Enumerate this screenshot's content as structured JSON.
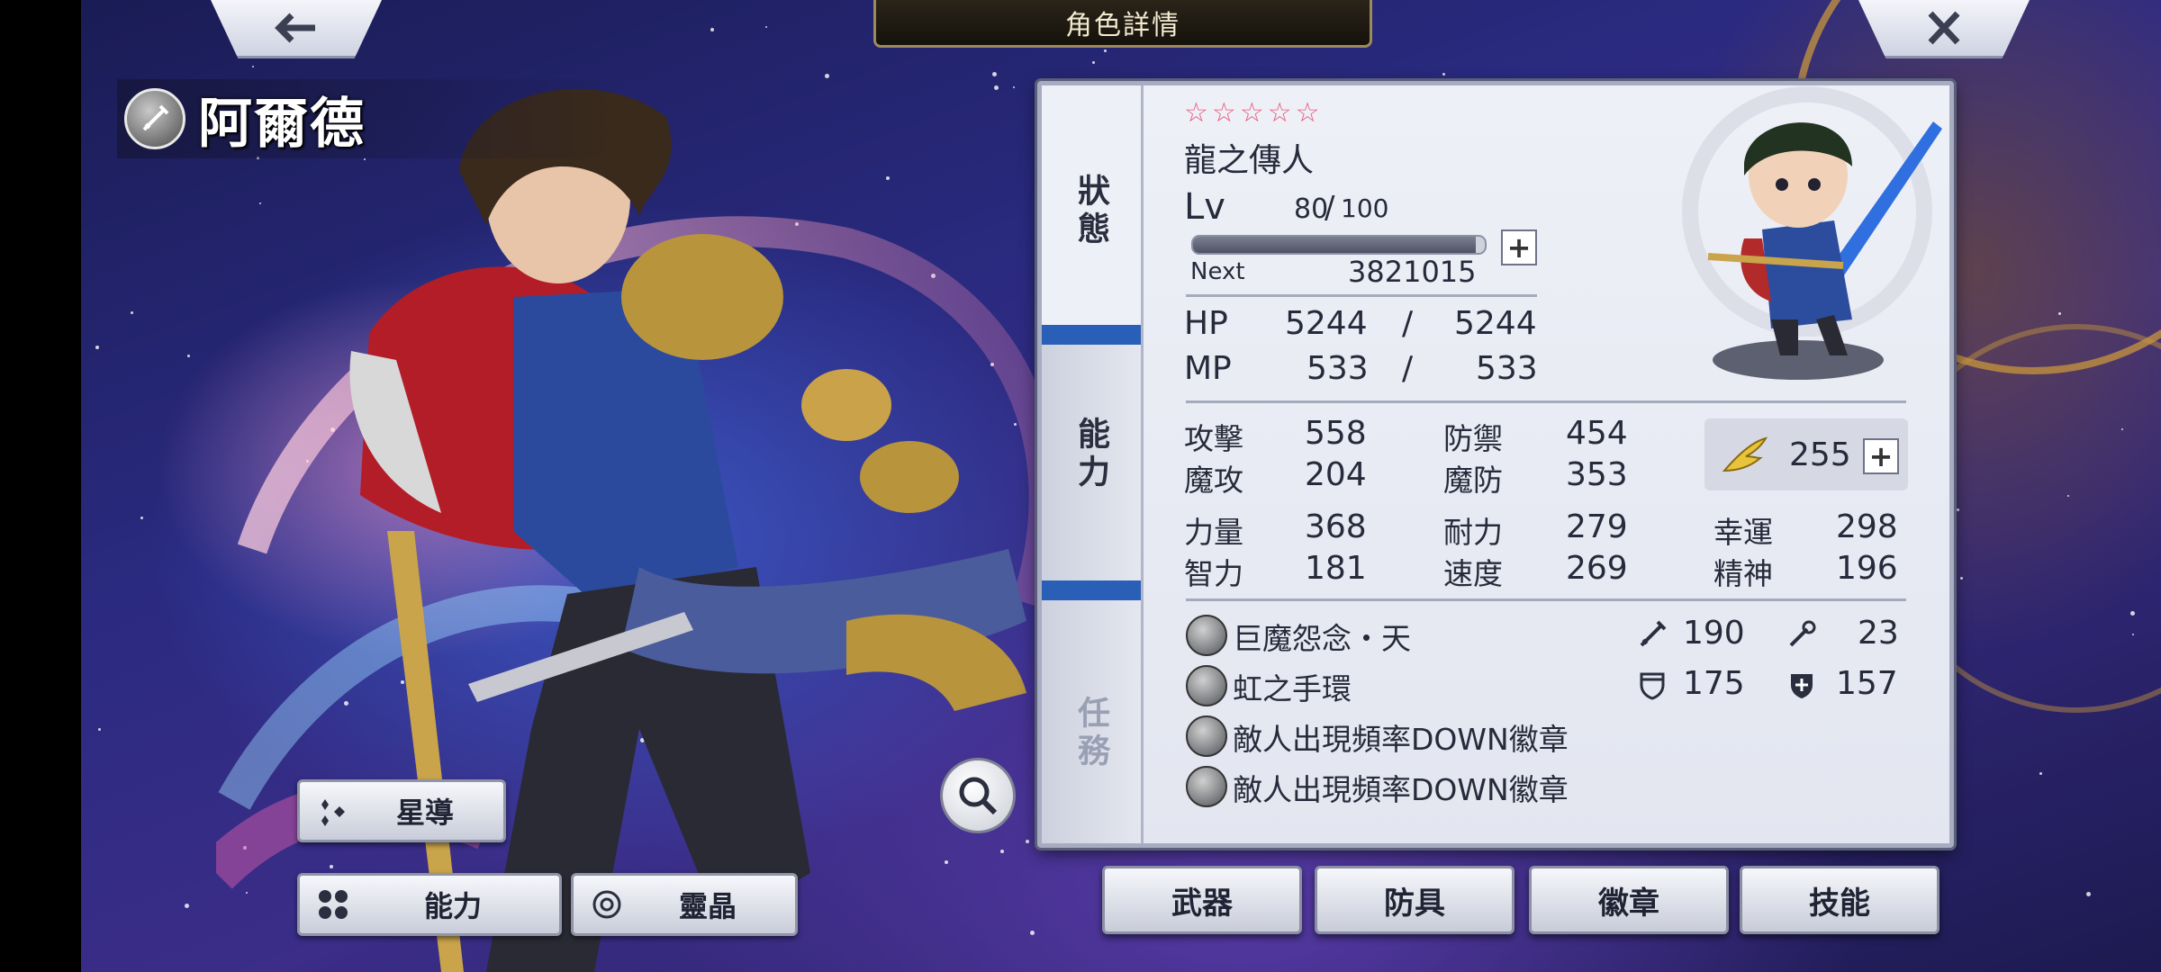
{
  "header": {
    "title": "角色詳情"
  },
  "character": {
    "name": "阿爾德",
    "stars": 5,
    "job": "龍之傳人",
    "level_label": "Lv",
    "level": "80",
    "level_max": "100",
    "level_sep": "/",
    "next_label": "Next",
    "next_value": "3821015",
    "xp_fraction": 0.97
  },
  "tabs": [
    {
      "label": "狀態"
    },
    {
      "label": "能力"
    },
    {
      "label": "任務"
    }
  ],
  "vitals": {
    "hp_label": "HP",
    "hp": "5244",
    "hp_max": "5244",
    "mp_label": "MP",
    "mp": "533",
    "mp_max": "533",
    "sep": "/"
  },
  "stats": {
    "atk_label": "攻擊",
    "atk": "558",
    "def_label": "防禦",
    "def": "454",
    "matk_label": "魔攻",
    "matk": "204",
    "mdef_label": "魔防",
    "mdef": "353",
    "str_label": "力量",
    "str": "368",
    "vit_label": "耐力",
    "vit": "279",
    "luk_label": "幸運",
    "luk": "298",
    "int_label": "智力",
    "int": "181",
    "spd_label": "速度",
    "spd": "269",
    "spi_label": "精神",
    "spi": "196",
    "boost_value": "255"
  },
  "equipment": [
    {
      "name": "巨魔怨念・天"
    },
    {
      "name": "虹之手環"
    },
    {
      "name": "敵人出現頻率DOWN徽章"
    },
    {
      "name": "敵人出現頻率DOWN徽章"
    }
  ],
  "equip_stats": {
    "phys_atk": "190",
    "mag_atk": "23",
    "phys_def": "175",
    "mag_def": "157"
  },
  "left_buttons": {
    "star_guide": "星導",
    "ability": "能力",
    "crystal": "靈晶"
  },
  "bottom_buttons": {
    "weapon": "武器",
    "armor": "防具",
    "badge": "徽章",
    "skill": "技能"
  },
  "colors": {
    "star": "#e9587a",
    "tab_accent": "#2a5fb8",
    "panel_bg": "#eef0f7"
  }
}
